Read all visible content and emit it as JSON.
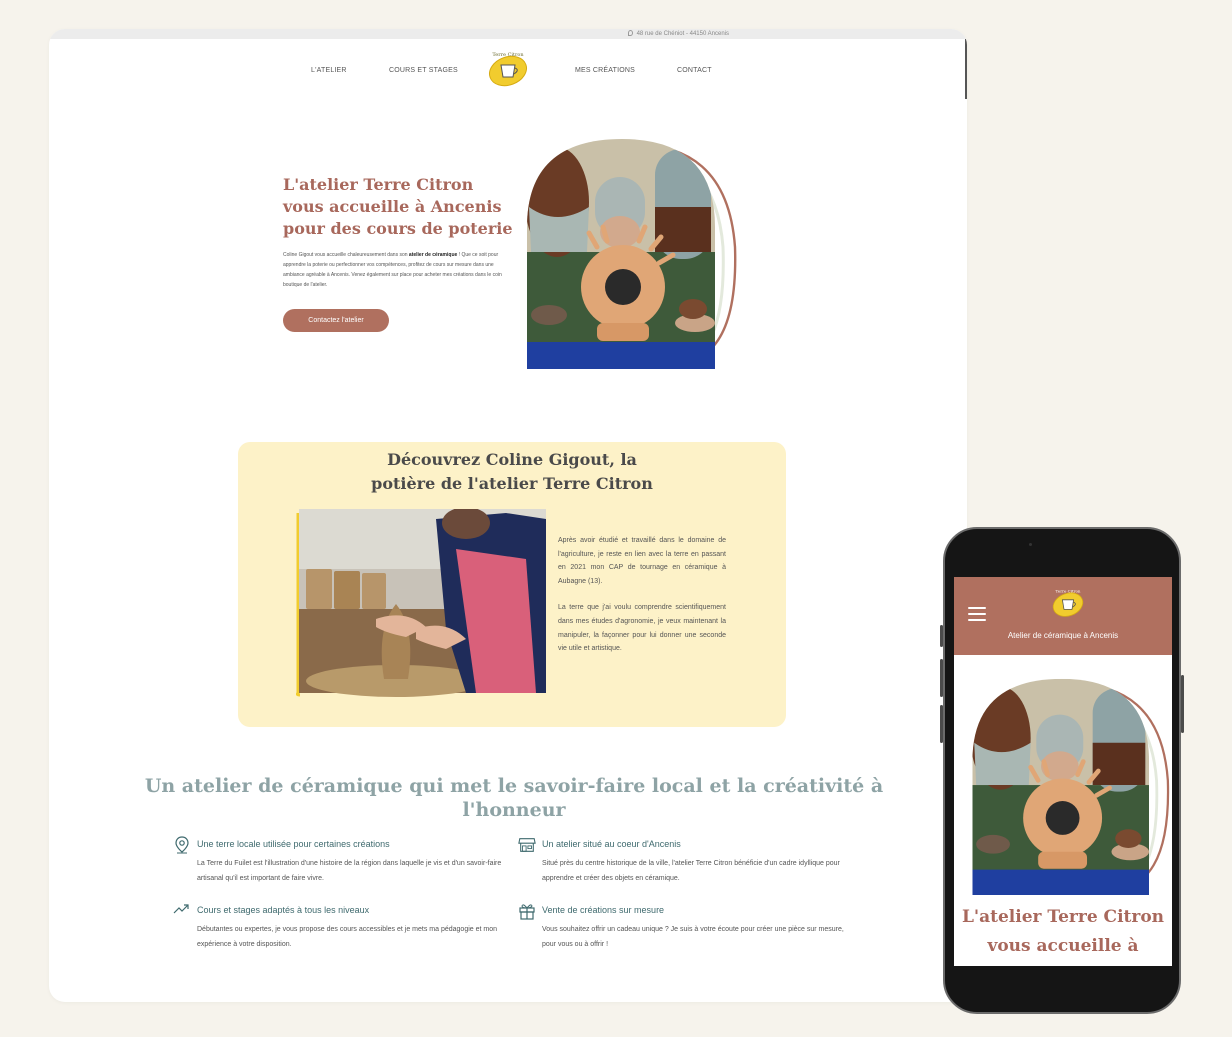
{
  "topbar": {
    "address": "48 rue de Chéniot - 44150 Ancenis"
  },
  "nav": {
    "items": [
      "L'ATELIER",
      "COURS ET STAGES",
      "MES CRÉATIONS",
      "CONTACT"
    ],
    "logo_text": "Terre Citron"
  },
  "hero": {
    "title": "L'atelier Terre Citron vous accueille à Ancenis pour des cours de poterie",
    "text_before": "Coline Gigout vous accueille chaleureusement dans son ",
    "text_bold": "atelier de céramique",
    "text_after": " ! Que ce soit pour apprendre la poterie ou perfectionner vos compétences, profitez de cours sur mesure dans une ambiance agréable à Ancenis. Venez également sur place pour acheter mes créations dans le coin boutique de l'atelier.",
    "button_label": "Contactez l'atelier"
  },
  "about": {
    "title_line1": "Découvrez Coline Gigout, la",
    "title_line2": "potière de l'atelier Terre Citron",
    "paragraph1": "Après avoir étudié et travaillé dans le domaine de l'agriculture, je reste en lien avec la terre en passant en 2021 mon CAP de tournage en céramique à Aubagne (13).",
    "paragraph2": "La terre que j'ai voulu comprendre scientifiquement dans mes études d'agronomie, je veux maintenant la manipuler, la façonner pour lui donner une seconde vie utile et artistique."
  },
  "features": {
    "title": "Un atelier de céramique qui met le savoir-faire local et la créativité à l'honneur",
    "items": [
      {
        "icon": "map-pin-icon",
        "title": "Une terre locale utilisée pour certaines créations",
        "text": "La Terre du Fuilet est l'illustration d'une histoire de la région dans laquelle je vis et d'un savoir-faire artisanal qu'il est important de faire vivre."
      },
      {
        "icon": "shop-icon",
        "title": "Un atelier situé au coeur d'Ancenis",
        "text": "Situé près du centre historique de la ville, l'atelier Terre Citron bénéficie d'un cadre idyllique pour apprendre et créer des objets en céramique."
      },
      {
        "icon": "trend-up-icon",
        "title": "Cours et stages adaptés à tous les niveaux",
        "text": "Débutantes ou expertes, je vous propose des cours accessibles et je mets ma pédagogie et mon expérience à votre disposition."
      },
      {
        "icon": "gift-icon",
        "title": "Vente de créations sur mesure",
        "text": "Vous souhaitez offrir un cadeau unique ? Je suis à votre écoute pour créer une pièce sur mesure, pour vous ou à offrir !"
      }
    ]
  },
  "mobile": {
    "tagline": "Atelier de céramique à Ancenis",
    "title": "L'atelier Terre Citron vous accueille à"
  },
  "colors": {
    "brand_terracotta": "#b0705f",
    "title_rose": "#a8685c",
    "card_yellow": "#fdf2c8",
    "teal_text": "#3f6a6e",
    "logo_yellow": "#f1cc2e"
  }
}
